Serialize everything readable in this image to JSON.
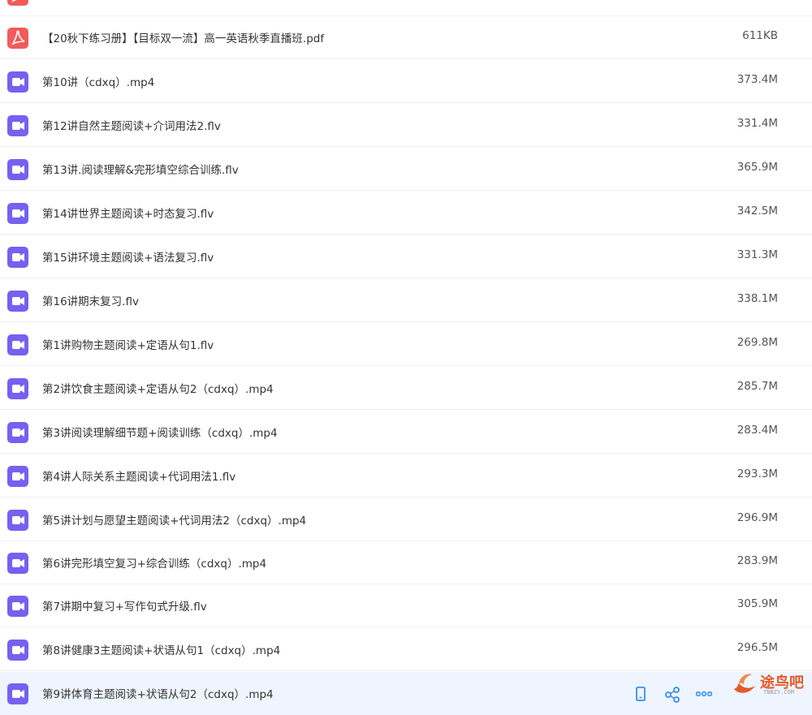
{
  "files": [
    {
      "name": "",
      "size": "",
      "type": "pdf"
    },
    {
      "name": "【20秋下练习册】【目标双一流】高一英语秋季直播班.pdf",
      "size": "611KB",
      "type": "pdf"
    },
    {
      "name": "第10讲（cdxq）.mp4",
      "size": "373.4M",
      "type": "video"
    },
    {
      "name": "第12讲自然主题阅读+介词用法2.flv",
      "size": "331.4M",
      "type": "video"
    },
    {
      "name": "第13讲.阅读理解&完形填空综合训练.flv",
      "size": "365.9M",
      "type": "video"
    },
    {
      "name": "第14讲世界主题阅读+时态复习.flv",
      "size": "342.5M",
      "type": "video"
    },
    {
      "name": "第15讲环境主题阅读+语法复习.flv",
      "size": "331.3M",
      "type": "video"
    },
    {
      "name": "第16讲期末复习.flv",
      "size": "338.1M",
      "type": "video"
    },
    {
      "name": "第1讲购物主题阅读+定语从句1.flv",
      "size": "269.8M",
      "type": "video"
    },
    {
      "name": "第2讲饮食主题阅读+定语从句2（cdxq）.mp4",
      "size": "285.7M",
      "type": "video"
    },
    {
      "name": "第3讲阅读理解细节题+阅读训练（cdxq）.mp4",
      "size": "283.4M",
      "type": "video"
    },
    {
      "name": "第4讲人际关系主题阅读+代词用法1.flv",
      "size": "293.3M",
      "type": "video"
    },
    {
      "name": "第5讲计划与愿望主题阅读+代词用法2（cdxq）.mp4",
      "size": "296.9M",
      "type": "video"
    },
    {
      "name": "第6讲完形填空复习+综合训练（cdxq）.mp4",
      "size": "283.9M",
      "type": "video"
    },
    {
      "name": "第7讲期中复习+写作句式升级.flv",
      "size": "305.9M",
      "type": "video"
    },
    {
      "name": "第8讲健康3主题阅读+状语从句1（cdxq）.mp4",
      "size": "296.5M",
      "type": "video"
    },
    {
      "name": "第9讲体育主题阅读+状语从句2（cdxq）.mp4",
      "size": "",
      "type": "video"
    }
  ],
  "row_actions": [
    "phone-icon",
    "share-icon",
    "more-icon"
  ],
  "watermark": {
    "text": "途鸟吧",
    "sub": "TNBZY.COM"
  },
  "colors": {
    "video_icon": "#7561f0",
    "pdf_icon": "#f25b5b",
    "hover_row": "#eef5fe",
    "watermark": "#e55a2b"
  }
}
